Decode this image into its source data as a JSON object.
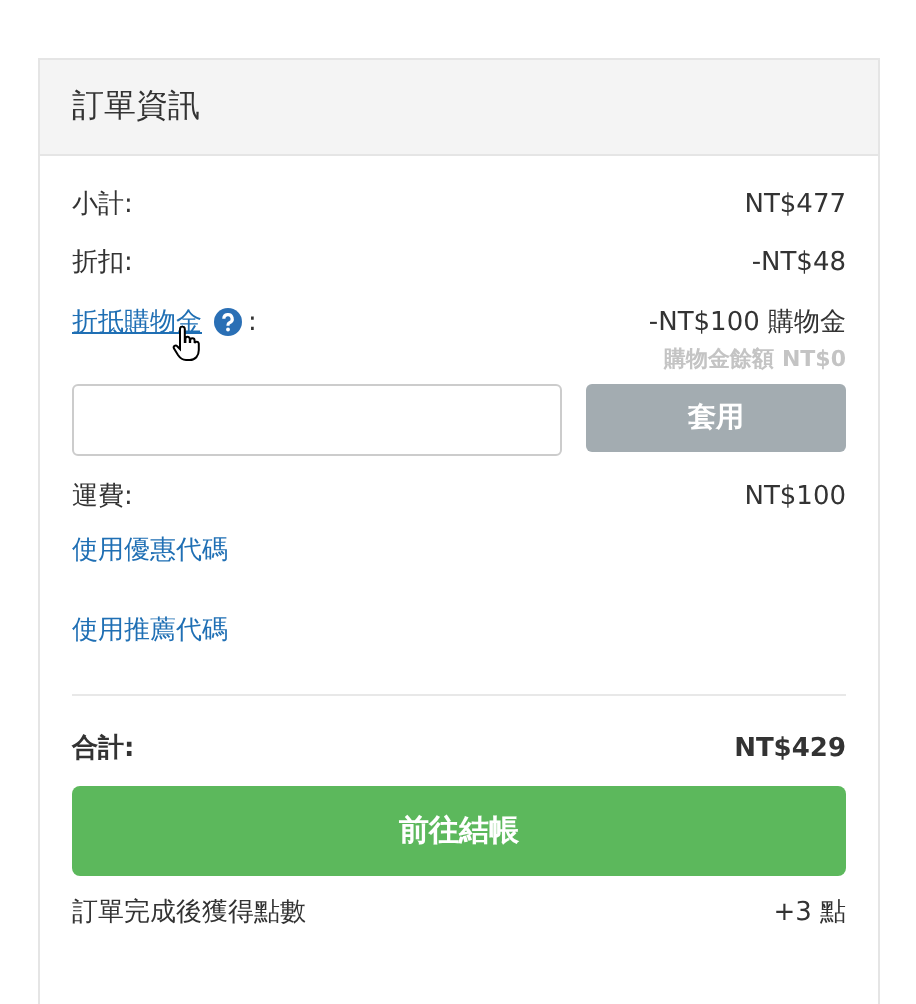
{
  "panel": {
    "title": "訂單資訊"
  },
  "subtotal": {
    "label": "小計:",
    "value": "NT$477"
  },
  "discount": {
    "label": "折扣:",
    "value": "-NT$48"
  },
  "credit": {
    "link": "折抵購物金",
    "colon": ":",
    "value": "-NT$100 購物金",
    "balance": "購物金餘額 NT$0",
    "apply_button": "套用",
    "apply_disabled": true
  },
  "shipping": {
    "label": "運費:",
    "value": "NT$100"
  },
  "links": [
    "使用優惠代碼",
    "使用推薦代碼"
  ],
  "total": {
    "label": "合計:",
    "value": "NT$429"
  },
  "checkout_button": "前往結帳",
  "points": {
    "label": "訂單完成後獲得點數",
    "value": "+3 點"
  }
}
